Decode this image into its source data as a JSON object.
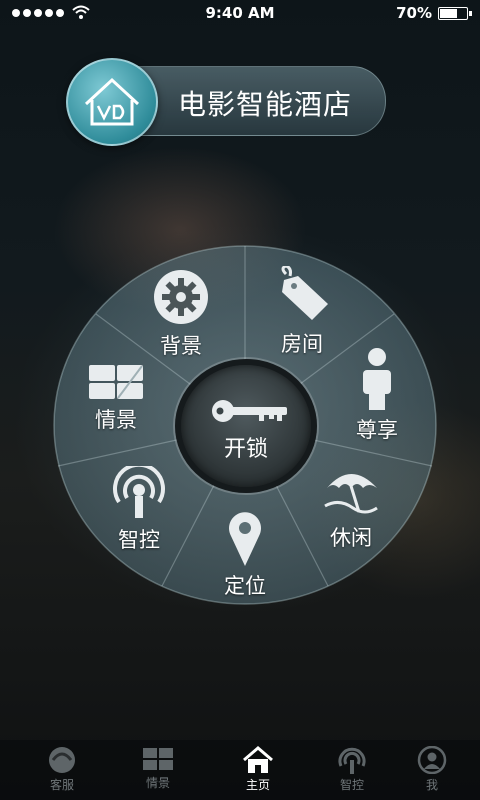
{
  "status_bar": {
    "time": "9:40 AM",
    "battery_text": "70%",
    "battery_level": 0.7
  },
  "brand": {
    "title": "电影智能酒店",
    "logo_icon": "house-logo-icon"
  },
  "wheel": {
    "center": {
      "label": "开锁",
      "icon": "key-icon"
    },
    "segments": [
      {
        "label": "背景",
        "icon": "gear-icon"
      },
      {
        "label": "房间",
        "icon": "room-tag-icon"
      },
      {
        "label": "尊享",
        "icon": "person-icon"
      },
      {
        "label": "休闲",
        "icon": "beach-umbrella-icon"
      },
      {
        "label": "定位",
        "icon": "location-pin-icon"
      },
      {
        "label": "智控",
        "icon": "broadcast-icon"
      },
      {
        "label": "情景",
        "icon": "scene-panel-icon"
      }
    ]
  },
  "tabbar": {
    "active_index": 2,
    "items": [
      {
        "label": "客服",
        "icon": "customer-service-icon"
      },
      {
        "label": "情景",
        "icon": "scene-panel-icon"
      },
      {
        "label": "主页",
        "icon": "home-icon"
      },
      {
        "label": "智控",
        "icon": "broadcast-icon"
      },
      {
        "label": "我",
        "icon": "user-icon"
      }
    ]
  }
}
